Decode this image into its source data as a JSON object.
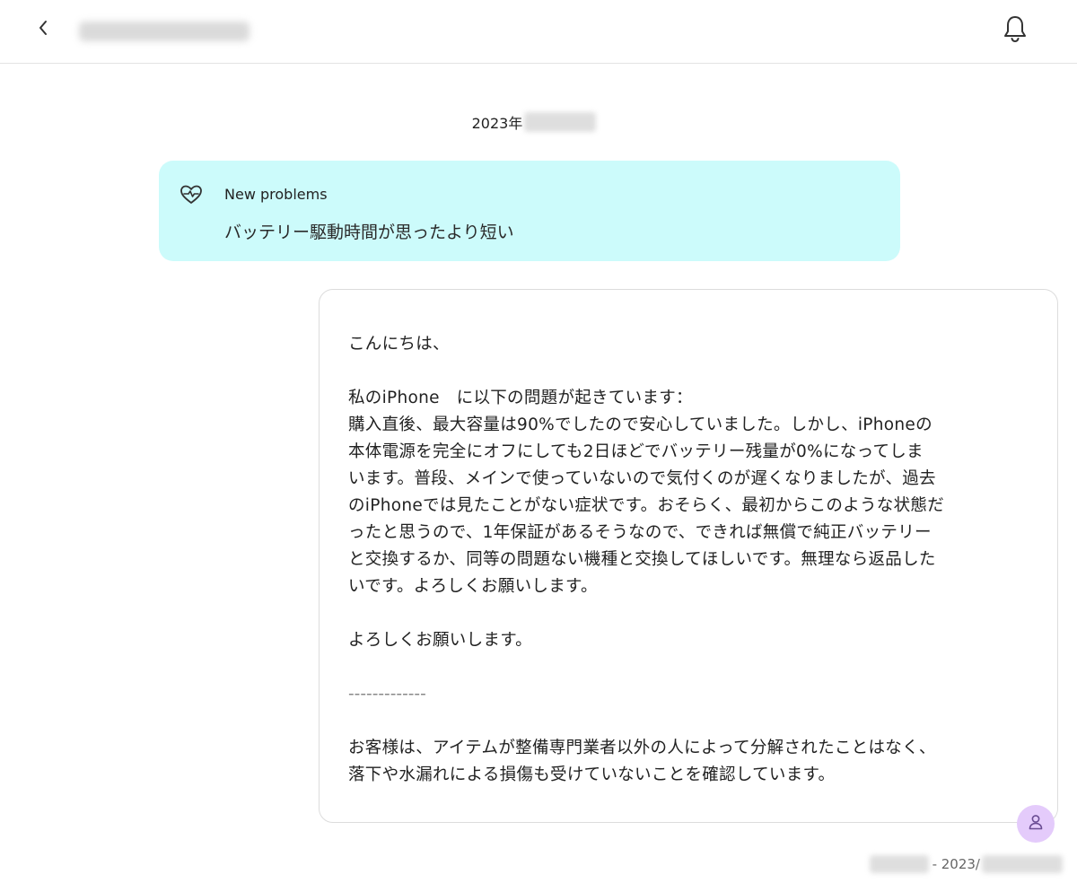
{
  "header": {
    "back_icon": "chevron-left-icon",
    "bell_icon": "bell-icon"
  },
  "date_separator": "2023年",
  "problem": {
    "icon": "heart-pulse-icon",
    "title": "New problems",
    "text": "バッテリー駆動時間が思ったより短い"
  },
  "message": {
    "greeting": "こんにちは、",
    "lines": [
      "私のiPhone　に以下の問題が起きています：",
      "購入直後、最大容量は90%でしたので安心していました。しかし、iPhoneの",
      "本体電源を完全にオフにしても2日ほどでバッテリー残量が0%になってしま",
      "います。普段、メインで使っていないので気付くのが遅くなりましたが、過去",
      "のiPhoneでは見たことがない症状です。おそらく、最初からこのような状態だ",
      "ったと思うので、1年保証があるそうなので、できれば無償で純正バッテリー",
      "と交換するか、同等の問題ない機種と交換してほしいです。無理なら返品した",
      "いです。よろしくお願いします。"
    ],
    "closing": "よろしくお願いします。",
    "divider": "-------------",
    "disclaimer_lines": [
      "お客様は、アイテムが整備専門業者以外の人によって分解されたことはなく、",
      "落下や水漏れによる損傷も受けていないことを確認しています。"
    ]
  },
  "avatar_icon": "user-icon",
  "footer": {
    "timestamp_partial": "- 2023/"
  }
}
